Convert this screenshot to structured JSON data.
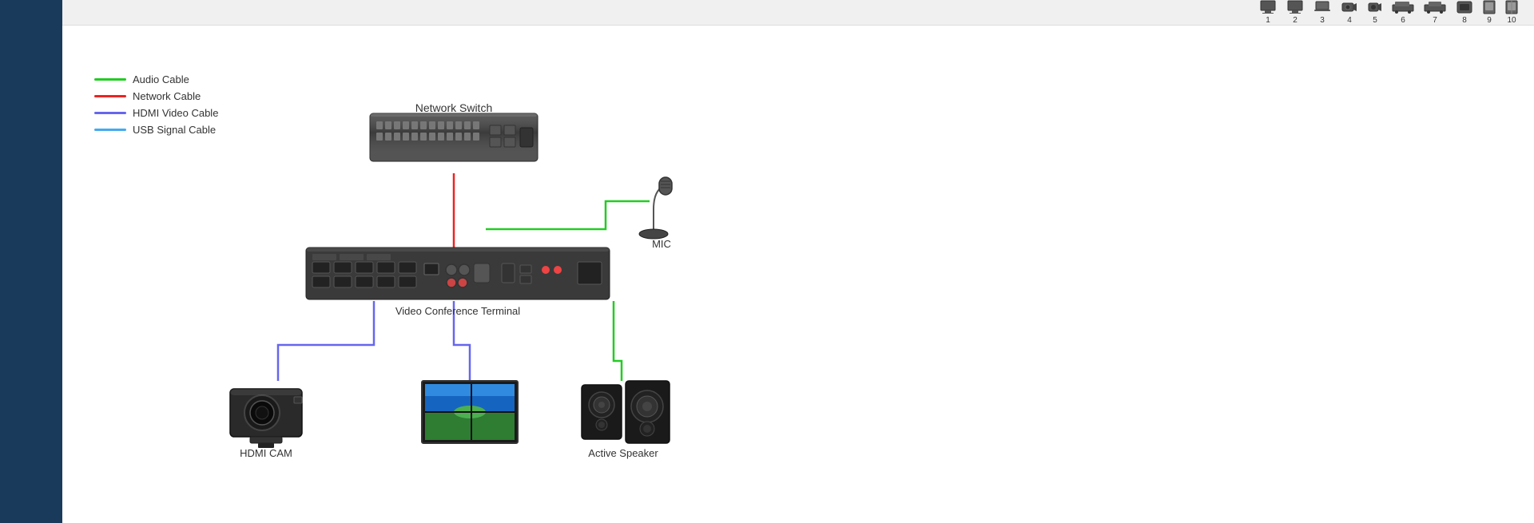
{
  "topBar": {
    "devices": [
      {
        "number": "1",
        "shape": "monitor"
      },
      {
        "number": "2",
        "shape": "monitor"
      },
      {
        "number": "3",
        "shape": "laptop"
      },
      {
        "number": "4",
        "shape": "camera"
      },
      {
        "number": "5",
        "shape": "small-cam"
      },
      {
        "number": "6",
        "shape": "vehicle"
      },
      {
        "number": "7",
        "shape": "vehicle2"
      },
      {
        "number": "8",
        "shape": "box"
      },
      {
        "number": "9",
        "shape": "panel"
      },
      {
        "number": "10",
        "shape": "panel2"
      }
    ]
  },
  "legend": {
    "items": [
      {
        "label": "Audio Cable",
        "color": "#22cc22"
      },
      {
        "label": "Network Cable",
        "color": "#ee2222"
      },
      {
        "label": "HDMI Video Cable",
        "color": "#6666ee"
      },
      {
        "label": "USB Signal Cable",
        "color": "#44aaee"
      }
    ]
  },
  "devices": {
    "networkSwitch": {
      "label": "Network Switch"
    },
    "mic": {
      "label": "MIC"
    },
    "vct": {
      "label": "Video Conference Terminal"
    },
    "camera": {
      "label": "HDMI CAM"
    },
    "monitor": {
      "label": ""
    },
    "speaker": {
      "label": "Active Speaker"
    }
  }
}
